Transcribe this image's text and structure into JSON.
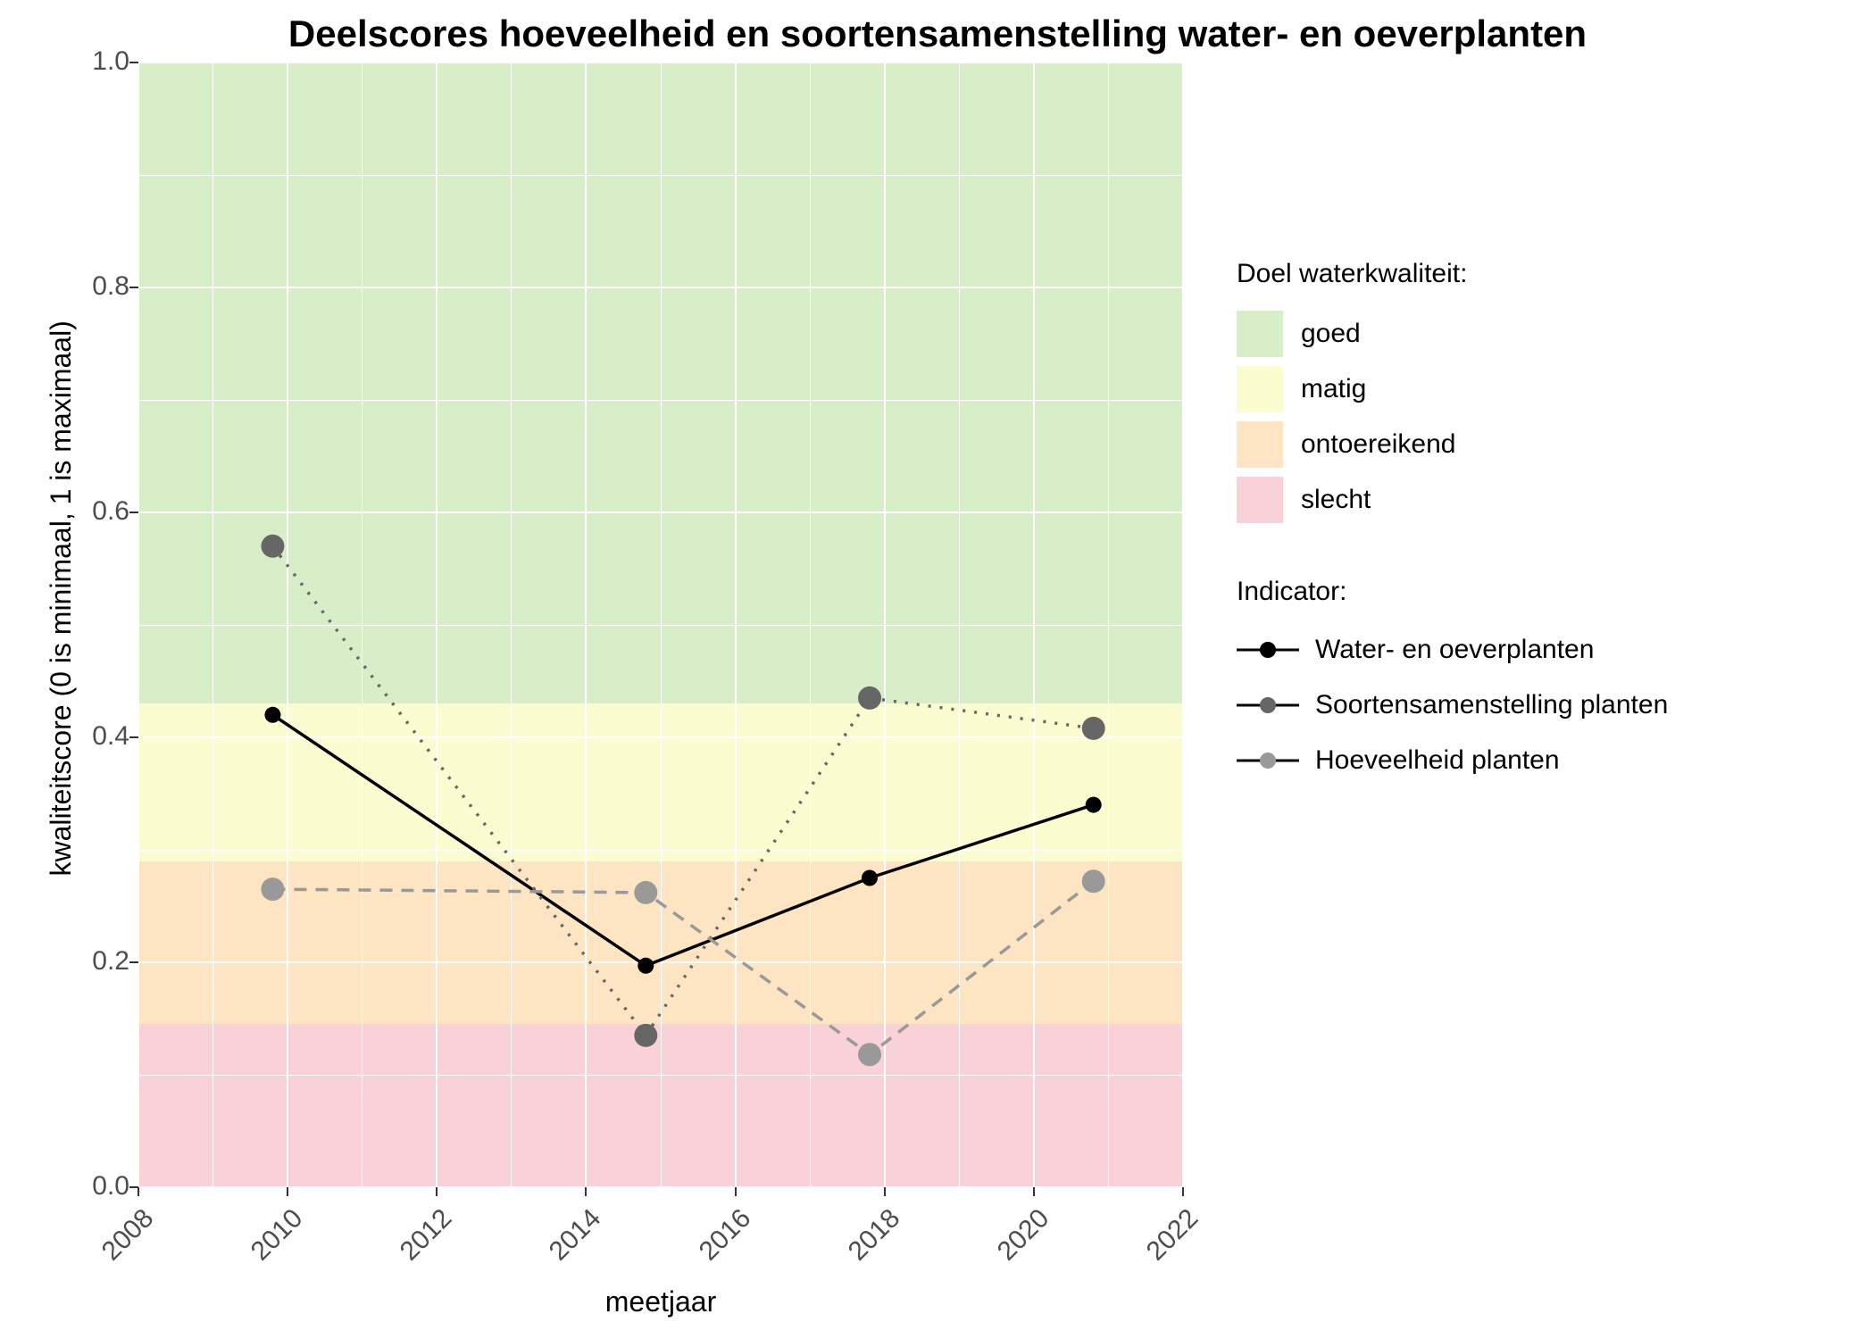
{
  "chart_data": {
    "type": "line",
    "title": "Deelscores hoeveelheid en soortensamenstelling water- en oeverplanten",
    "xlabel": "meetjaar",
    "ylabel": "kwaliteitscore (0 is minimaal, 1 is maximaal)",
    "xlim": [
      2008,
      2022
    ],
    "ylim": [
      0,
      1
    ],
    "x_ticks": [
      2008,
      2010,
      2012,
      2014,
      2016,
      2018,
      2020,
      2022
    ],
    "y_ticks": [
      0.0,
      0.2,
      0.4,
      0.6,
      0.8,
      1.0
    ],
    "bands": {
      "title": "Doel waterkwaliteit:",
      "levels": [
        {
          "name": "goed",
          "from": 0.43,
          "to": 1.0,
          "color": "#d7eec9"
        },
        {
          "name": "matig",
          "from": 0.29,
          "to": 0.43,
          "color": "#fbfcd0"
        },
        {
          "name": "ontoereikend",
          "from": 0.145,
          "to": 0.29,
          "color": "#fde5c4"
        },
        {
          "name": "slecht",
          "from": 0.0,
          "to": 0.145,
          "color": "#f8d2d8"
        }
      ]
    },
    "legend_indicator_title": "Indicator:",
    "series": [
      {
        "name": "Water- en oeverplanten",
        "linestyle": "solid",
        "color": "#000000",
        "x": [
          2009.8,
          2014.8,
          2017.8,
          2020.8
        ],
        "y": [
          0.42,
          0.197,
          0.275,
          0.34
        ]
      },
      {
        "name": "Soortensamenstelling planten",
        "linestyle": "dotted",
        "color": "#666666",
        "x": [
          2009.8,
          2014.8,
          2017.8,
          2020.8
        ],
        "y": [
          0.57,
          0.135,
          0.435,
          0.408
        ]
      },
      {
        "name": "Hoeveelheid planten",
        "linestyle": "dashed",
        "color": "#999999",
        "x": [
          2009.8,
          2014.8,
          2017.8,
          2020.8
        ],
        "y": [
          0.265,
          0.262,
          0.118,
          0.272
        ]
      }
    ]
  }
}
